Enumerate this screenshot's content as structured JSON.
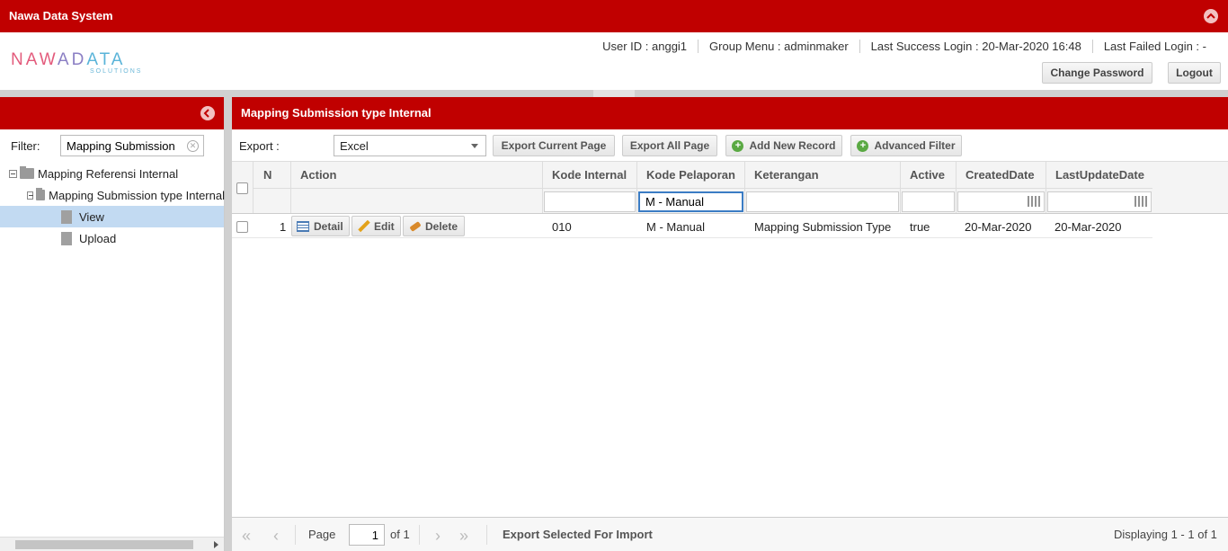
{
  "app": {
    "title": "Nawa Data System"
  },
  "logo": {
    "main": "NAWADATA",
    "sub": "SOLUTIONS"
  },
  "user": {
    "user_id": "User ID : anggi1",
    "group_menu": "Group Menu : adminmaker",
    "last_success": "Last Success Login : 20-Mar-2020 16:48",
    "last_failed": "Last Failed Login : -"
  },
  "header_buttons": {
    "change_password": "Change Password",
    "logout": "Logout"
  },
  "sidebar": {
    "filter_label": "Filter:",
    "filter_value": "Mapping Submission",
    "tree": [
      {
        "label": "Mapping Referensi Internal"
      },
      {
        "label": "Mapping Submission type Internal"
      },
      {
        "label": "View"
      },
      {
        "label": "Upload"
      }
    ]
  },
  "main": {
    "title": "Mapping Submission type Internal",
    "toolbar": {
      "export_label": "Export :",
      "export_value": "Excel",
      "export_current": "Export Current Page",
      "export_all": "Export All Page",
      "add_new": "Add New Record",
      "advanced_filter": "Advanced Filter"
    },
    "columns": [
      "N",
      "Action",
      "Kode Internal",
      "Kode Pelaporan",
      "Keterangan",
      "Active",
      "CreatedDate",
      "LastUpdateDate"
    ],
    "filter_kode_pelaporan": "M - Manual",
    "row": {
      "n": "1",
      "btn_detail": "Detail",
      "btn_edit": "Edit",
      "btn_delete": "Delete",
      "kode_internal": "010",
      "kode_pelaporan": "M - Manual",
      "keterangan": "Mapping Submission Type",
      "active": "true",
      "created": "20-Mar-2020",
      "updated": "20-Mar-2020"
    },
    "pager": {
      "page_label": "Page",
      "page_value": "1",
      "of_label": "of 1",
      "export_selected": "Export Selected For Import",
      "displaying": "Displaying 1 - 1 of 1"
    }
  },
  "colors": {
    "brand_red": "#c00000",
    "selected_row": "#c2daf2",
    "add_green": "#5aa943"
  }
}
